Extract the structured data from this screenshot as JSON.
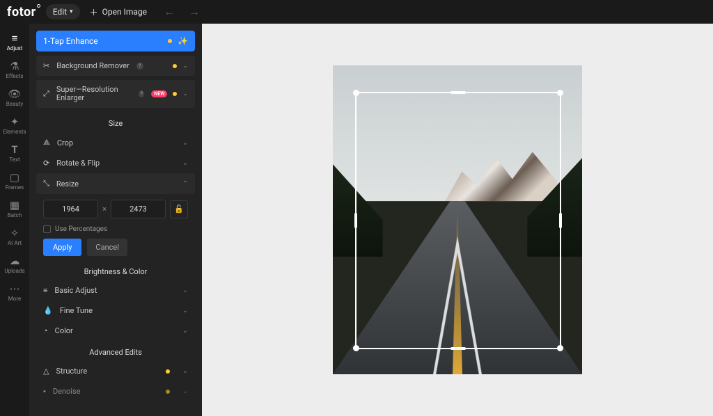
{
  "topbar": {
    "logo": "fotor",
    "edit": "Edit",
    "open_image": "Open Image"
  },
  "iconbar": [
    {
      "key": "adjust",
      "label": "Adjust",
      "icon": "⚙"
    },
    {
      "key": "effects",
      "label": "Effects",
      "icon": "◆"
    },
    {
      "key": "beauty",
      "label": "Beauty",
      "icon": "👁"
    },
    {
      "key": "elements",
      "label": "Elements",
      "icon": "✦"
    },
    {
      "key": "text",
      "label": "Text",
      "icon": "T"
    },
    {
      "key": "frames",
      "label": "Frames",
      "icon": "▢"
    },
    {
      "key": "batch",
      "label": "Batch",
      "icon": "▦"
    },
    {
      "key": "ai_art",
      "label": "AI Art",
      "icon": "✧"
    },
    {
      "key": "uploads",
      "label": "Uploads",
      "icon": "⬆"
    },
    {
      "key": "more",
      "label": "More",
      "icon": "⋯"
    }
  ],
  "panel": {
    "enhance": "1-Tap Enhance",
    "bg_remover": "Background Remover",
    "sr_enlarger": "Super—Resolution Enlarger",
    "new_badge": "NEW",
    "sections": {
      "size": "Size",
      "brightness": "Brightness & Color",
      "advanced": "Advanced Edits"
    },
    "size_items": {
      "crop": "Crop",
      "rotate": "Rotate & Flip",
      "resize": "Resize"
    },
    "resize": {
      "width": "1964",
      "height": "2473",
      "use_pct": "Use Percentages",
      "apply": "Apply",
      "cancel": "Cancel"
    },
    "bc_items": {
      "basic": "Basic Adjust",
      "fine": "Fine Tune",
      "color": "Color"
    },
    "adv_items": {
      "structure": "Structure",
      "denoise": "Denoise"
    }
  }
}
